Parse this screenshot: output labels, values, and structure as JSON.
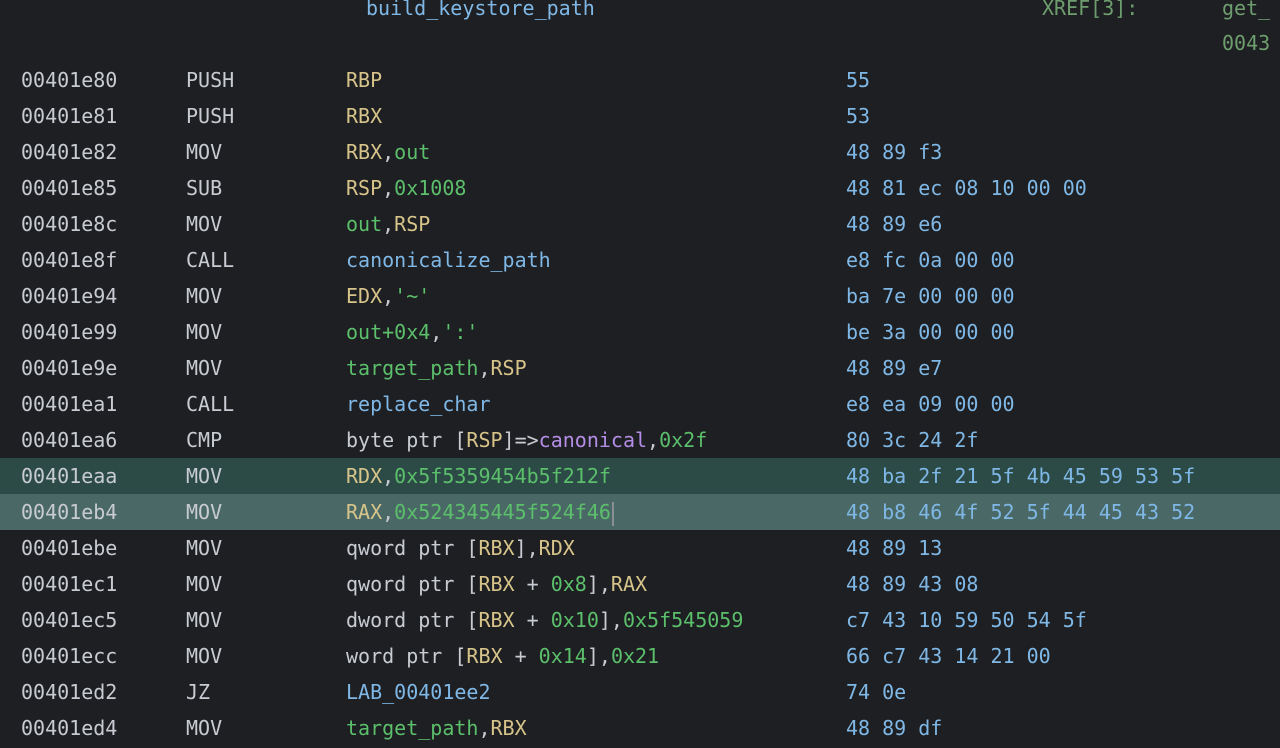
{
  "header": {
    "function_name": "build_keystore_path",
    "xref_label": "XREF[3]:",
    "xref_refs": [
      "get_",
      "0043"
    ]
  },
  "colors": {
    "background": "#1e1f22",
    "selection_primary": "#2c4b47",
    "selection_secondary": "#4a6966",
    "register": "#d7c48a",
    "variable_or_constant": "#5bbf6b",
    "function_or_label": "#7fb8e6",
    "field": "#b48ee6"
  },
  "listing": [
    {
      "address": "00401e80",
      "mnemonic": "PUSH",
      "operands": [
        {
          "t": "reg",
          "s": "RBP"
        }
      ],
      "bytes": "55"
    },
    {
      "address": "00401e81",
      "mnemonic": "PUSH",
      "operands": [
        {
          "t": "reg",
          "s": "RBX"
        }
      ],
      "bytes": "53"
    },
    {
      "address": "00401e82",
      "mnemonic": "MOV",
      "operands": [
        {
          "t": "reg",
          "s": "RBX"
        },
        {
          "t": "text",
          "s": ","
        },
        {
          "t": "var",
          "s": "out"
        }
      ],
      "bytes": "48 89 f3"
    },
    {
      "address": "00401e85",
      "mnemonic": "SUB",
      "operands": [
        {
          "t": "reg",
          "s": "RSP"
        },
        {
          "t": "text",
          "s": ","
        },
        {
          "t": "num",
          "s": "0x1008"
        }
      ],
      "bytes": "48 81 ec 08 10 00 00"
    },
    {
      "address": "00401e8c",
      "mnemonic": "MOV",
      "operands": [
        {
          "t": "var",
          "s": "out"
        },
        {
          "t": "text",
          "s": ","
        },
        {
          "t": "reg",
          "s": "RSP"
        }
      ],
      "bytes": "48 89 e6"
    },
    {
      "address": "00401e8f",
      "mnemonic": "CALL",
      "operands": [
        {
          "t": "func",
          "s": "canonicalize_path"
        }
      ],
      "bytes": "e8 fc 0a 00 00"
    },
    {
      "address": "00401e94",
      "mnemonic": "MOV",
      "operands": [
        {
          "t": "reg",
          "s": "EDX"
        },
        {
          "t": "text",
          "s": ","
        },
        {
          "t": "num",
          "s": "'~'"
        }
      ],
      "bytes": "ba 7e 00 00 00"
    },
    {
      "address": "00401e99",
      "mnemonic": "MOV",
      "operands": [
        {
          "t": "var",
          "s": "out+0x4"
        },
        {
          "t": "text",
          "s": ","
        },
        {
          "t": "num",
          "s": "':'"
        }
      ],
      "bytes": "be 3a 00 00 00"
    },
    {
      "address": "00401e9e",
      "mnemonic": "MOV",
      "operands": [
        {
          "t": "var",
          "s": "target_path"
        },
        {
          "t": "text",
          "s": ","
        },
        {
          "t": "reg",
          "s": "RSP"
        }
      ],
      "bytes": "48 89 e7"
    },
    {
      "address": "00401ea1",
      "mnemonic": "CALL",
      "operands": [
        {
          "t": "func",
          "s": "replace_char"
        }
      ],
      "bytes": "e8 ea 09 00 00"
    },
    {
      "address": "00401ea6",
      "mnemonic": "CMP",
      "operands": [
        {
          "t": "text",
          "s": "byte ptr ["
        },
        {
          "t": "reg",
          "s": "RSP"
        },
        {
          "t": "text",
          "s": "]=>"
        },
        {
          "t": "field",
          "s": "canonical"
        },
        {
          "t": "text",
          "s": ","
        },
        {
          "t": "num",
          "s": "0x2f"
        }
      ],
      "bytes": "80 3c 24 2f"
    },
    {
      "address": "00401eaa",
      "mnemonic": "MOV",
      "operands": [
        {
          "t": "reg",
          "s": "RDX"
        },
        {
          "t": "text",
          "s": ","
        },
        {
          "t": "num",
          "s": "0x5f5359454b5f212f"
        }
      ],
      "bytes": "48 ba 2f 21 5f 4b 45 59 53 5f",
      "selected": "primary"
    },
    {
      "address": "00401eb4",
      "mnemonic": "MOV",
      "operands": [
        {
          "t": "reg",
          "s": "RAX"
        },
        {
          "t": "text",
          "s": ","
        },
        {
          "t": "num",
          "s": "0x524345445f524f46"
        }
      ],
      "bytes": "48 b8 46 4f 52 5f 44 45 43 52",
      "selected": "secondary",
      "cursor": true
    },
    {
      "address": "00401ebe",
      "mnemonic": "MOV",
      "operands": [
        {
          "t": "text",
          "s": "qword ptr ["
        },
        {
          "t": "reg",
          "s": "RBX"
        },
        {
          "t": "text",
          "s": "],"
        },
        {
          "t": "reg",
          "s": "RDX"
        }
      ],
      "bytes": "48 89 13"
    },
    {
      "address": "00401ec1",
      "mnemonic": "MOV",
      "operands": [
        {
          "t": "text",
          "s": "qword ptr ["
        },
        {
          "t": "reg",
          "s": "RBX"
        },
        {
          "t": "text",
          "s": " + "
        },
        {
          "t": "num",
          "s": "0x8"
        },
        {
          "t": "text",
          "s": "],"
        },
        {
          "t": "reg",
          "s": "RAX"
        }
      ],
      "bytes": "48 89 43 08"
    },
    {
      "address": "00401ec5",
      "mnemonic": "MOV",
      "operands": [
        {
          "t": "text",
          "s": "dword ptr ["
        },
        {
          "t": "reg",
          "s": "RBX"
        },
        {
          "t": "text",
          "s": " + "
        },
        {
          "t": "num",
          "s": "0x10"
        },
        {
          "t": "text",
          "s": "],"
        },
        {
          "t": "num",
          "s": "0x5f545059"
        }
      ],
      "bytes": "c7 43 10 59 50 54 5f"
    },
    {
      "address": "00401ecc",
      "mnemonic": "MOV",
      "operands": [
        {
          "t": "text",
          "s": "word ptr ["
        },
        {
          "t": "reg",
          "s": "RBX"
        },
        {
          "t": "text",
          "s": " + "
        },
        {
          "t": "num",
          "s": "0x14"
        },
        {
          "t": "text",
          "s": "],"
        },
        {
          "t": "num",
          "s": "0x21"
        }
      ],
      "bytes": "66 c7 43 14 21 00"
    },
    {
      "address": "00401ed2",
      "mnemonic": "JZ",
      "operands": [
        {
          "t": "lab",
          "s": "LAB_00401ee2"
        }
      ],
      "bytes": "74 0e"
    },
    {
      "address": "00401ed4",
      "mnemonic": "MOV",
      "operands": [
        {
          "t": "var",
          "s": "target_path"
        },
        {
          "t": "text",
          "s": ","
        },
        {
          "t": "reg",
          "s": "RBX"
        }
      ],
      "bytes": "48 89 df"
    }
  ]
}
